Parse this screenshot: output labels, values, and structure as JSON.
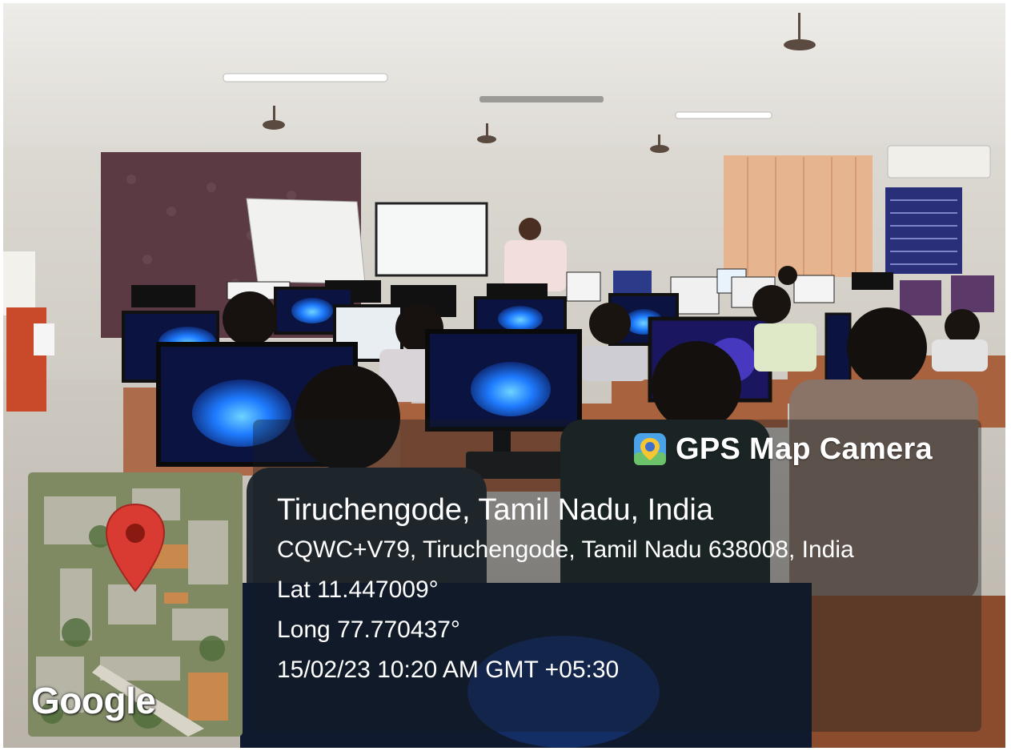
{
  "stamp": {
    "app_name": "GPS Map Camera",
    "location_title": "Tiruchengode, Tamil Nadu, India",
    "address": "CQWC+V79, Tiruchengode, Tamil Nadu 638008, India",
    "latitude": "Lat 11.447009°",
    "longitude": "Long 77.770437°",
    "datetime": "15/02/23 10:20 AM GMT +05:30",
    "map_brand": "Google",
    "pin_color": "#d93a32"
  },
  "colors": {
    "wall": "#d9d6cf",
    "ceiling": "#e8e6e1",
    "curtain_left": "#5a3a42",
    "curtain_right": "#e9b58f",
    "desk": "#a8623e",
    "screen_accent": "#3ab2ff"
  }
}
